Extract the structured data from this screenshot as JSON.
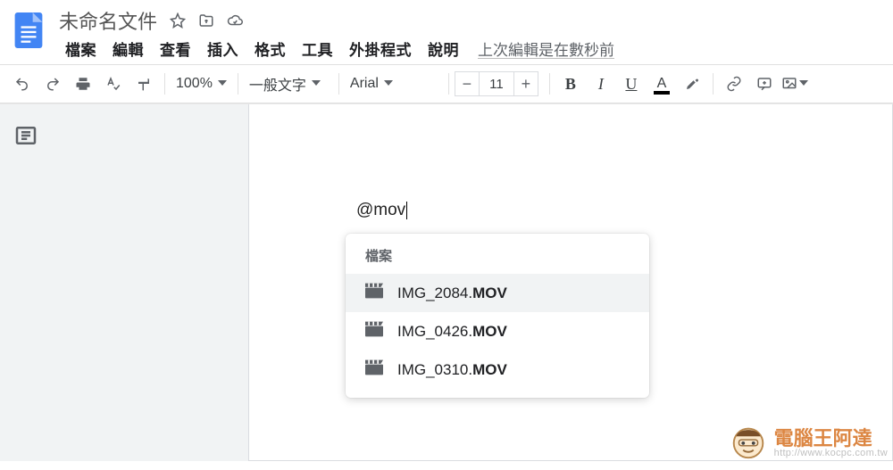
{
  "doc": {
    "title": "未命名文件"
  },
  "menu": {
    "items": [
      "檔案",
      "編輯",
      "查看",
      "插入",
      "格式",
      "工具",
      "外掛程式",
      "說明"
    ],
    "last_edit": "上次編輯是在數秒前"
  },
  "toolbar": {
    "zoom": "100%",
    "style": "一般文字",
    "font": "Arial",
    "font_size": "11"
  },
  "editor": {
    "typed_text": "@mov"
  },
  "dropdown": {
    "section_label": "檔案",
    "items": [
      {
        "prefix": "IMG_2084.",
        "bold": "MOV",
        "selected": true
      },
      {
        "prefix": "IMG_0426.",
        "bold": "MOV",
        "selected": false
      },
      {
        "prefix": "IMG_0310.",
        "bold": "MOV",
        "selected": false
      }
    ]
  },
  "watermark": {
    "brand": "電腦王阿達",
    "url": "http://www.kocpc.com.tw"
  }
}
